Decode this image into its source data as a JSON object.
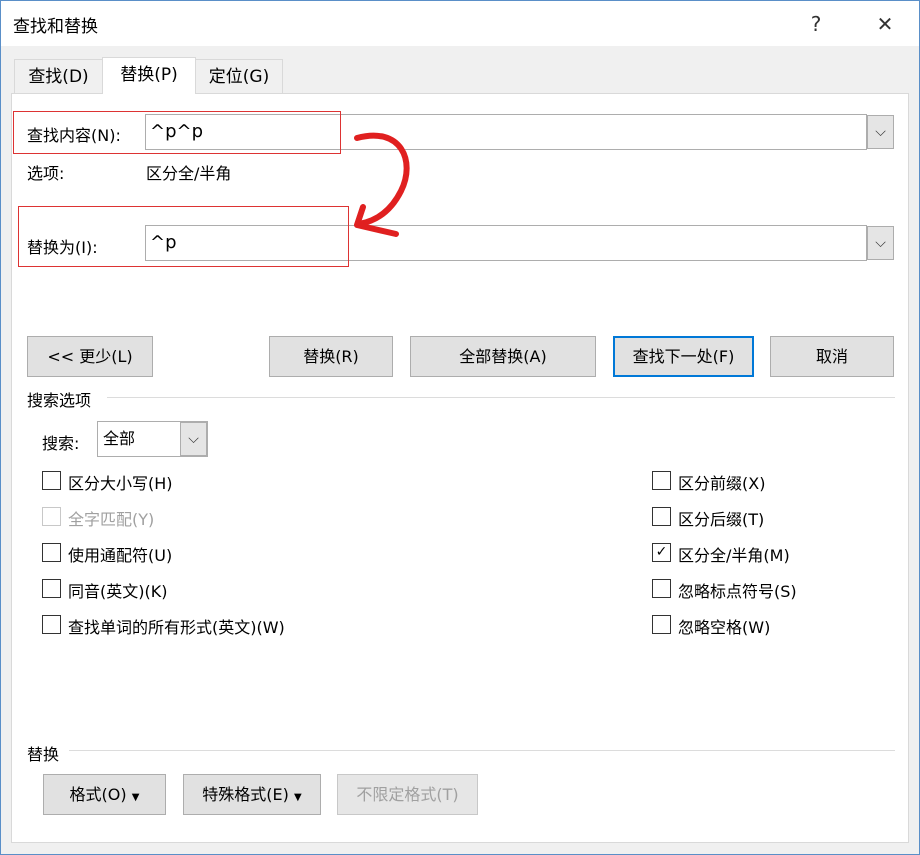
{
  "window": {
    "title": "查找和替换",
    "help": "?",
    "close": "✕"
  },
  "tabs": [
    {
      "label": "查找(D)"
    },
    {
      "label": "替换(P)"
    },
    {
      "label": "定位(G)"
    }
  ],
  "find": {
    "label": "查找内容(N):",
    "value": "^p^p"
  },
  "options": {
    "label": "选项:",
    "value": "区分全/半角"
  },
  "replace": {
    "label": "替换为(I):",
    "value": "^p"
  },
  "buttons": {
    "less": "<< 更少(L)",
    "replace": "替换(R)",
    "replace_all": "全部替换(A)",
    "find_next": "查找下一处(F)",
    "cancel": "取消"
  },
  "search_options": {
    "title": "搜索选项",
    "search_label": "搜索:",
    "search_value": "全部"
  },
  "checkboxes_left": [
    {
      "label": "区分大小写(H)",
      "checked": false,
      "disabled": false
    },
    {
      "label": "全字匹配(Y)",
      "checked": false,
      "disabled": true
    },
    {
      "label": "使用通配符(U)",
      "checked": false,
      "disabled": false
    },
    {
      "label": "同音(英文)(K)",
      "checked": false,
      "disabled": false
    },
    {
      "label": "查找单词的所有形式(英文)(W)",
      "checked": false,
      "disabled": false
    }
  ],
  "checkboxes_right": [
    {
      "label": "区分前缀(X)",
      "checked": false
    },
    {
      "label": "区分后缀(T)",
      "checked": false
    },
    {
      "label": "区分全/半角(M)",
      "checked": true
    },
    {
      "label": "忽略标点符号(S)",
      "checked": false
    },
    {
      "label": "忽略空格(W)",
      "checked": false
    }
  ],
  "replace_section": {
    "title": "替换",
    "format": "格式(O)",
    "special": "特殊格式(E)",
    "no_format": "不限定格式(T)"
  },
  "colors": {
    "annotation": "#e02020",
    "accent": "#0078d7"
  }
}
